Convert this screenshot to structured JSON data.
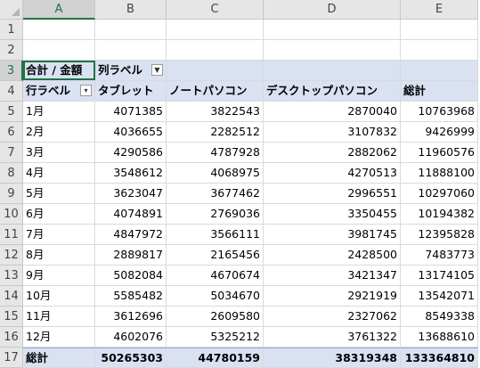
{
  "column_headers": [
    "A",
    "B",
    "C",
    "D",
    "E"
  ],
  "row_headers": [
    "1",
    "2",
    "3",
    "4",
    "5",
    "6",
    "7",
    "8",
    "9",
    "10",
    "11",
    "12",
    "13",
    "14",
    "15",
    "16",
    "17"
  ],
  "pivot": {
    "value_field": "合計 / 金額",
    "column_label": "列ラベル",
    "row_label": "行ラベル",
    "headers": [
      "タブレット",
      "ノートパソコン",
      "デスクトップパソコン",
      "総計"
    ],
    "rows": [
      {
        "label": "1月",
        "values": [
          "4071385",
          "3822543",
          "2870040",
          "10763968"
        ]
      },
      {
        "label": "2月",
        "values": [
          "4036655",
          "2282512",
          "3107832",
          "9426999"
        ]
      },
      {
        "label": "3月",
        "values": [
          "4290586",
          "4787928",
          "2882062",
          "11960576"
        ]
      },
      {
        "label": "4月",
        "values": [
          "3548612",
          "4068975",
          "4270513",
          "11888100"
        ]
      },
      {
        "label": "5月",
        "values": [
          "3623047",
          "3677462",
          "2996551",
          "10297060"
        ]
      },
      {
        "label": "6月",
        "values": [
          "4074891",
          "2769036",
          "3350455",
          "10194382"
        ]
      },
      {
        "label": "7月",
        "values": [
          "4847972",
          "3566111",
          "3981745",
          "12395828"
        ]
      },
      {
        "label": "8月",
        "values": [
          "2889817",
          "2165456",
          "2428500",
          "7483773"
        ]
      },
      {
        "label": "9月",
        "values": [
          "5082084",
          "4670674",
          "3421347",
          "13174105"
        ]
      },
      {
        "label": "10月",
        "values": [
          "5585482",
          "5034670",
          "2921919",
          "13542071"
        ]
      },
      {
        "label": "11月",
        "values": [
          "3612696",
          "2609580",
          "2327062",
          "8549338"
        ]
      },
      {
        "label": "12月",
        "values": [
          "4602076",
          "5325212",
          "3761322",
          "13688610"
        ]
      }
    ],
    "total_label": "総計",
    "totals": [
      "50265303",
      "44780159",
      "38319348",
      "133364810"
    ]
  },
  "icons": {
    "filter": "filter-icon",
    "dropdown": "dropdown-arrow-icon"
  },
  "colors": {
    "band": "#d9e1f2",
    "selection": "#217346"
  }
}
